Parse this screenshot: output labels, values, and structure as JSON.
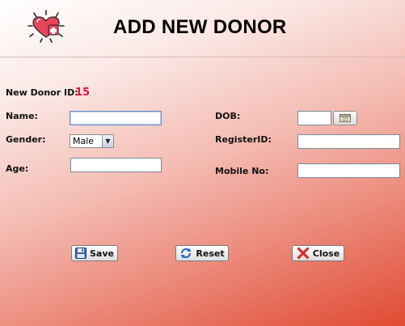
{
  "header": {
    "title": "ADD NEW DONOR",
    "logo_icon": "heart-logo-icon"
  },
  "donor": {
    "id_label": "New Donor ID:",
    "id_value": "15"
  },
  "form": {
    "name_label": "Name:",
    "name_value": "",
    "gender_label": "Gender:",
    "gender_value": "Male",
    "age_label": "Age:",
    "age_value": "",
    "dob_label": "DOB:",
    "dob_value": "",
    "register_label": "RegisterID:",
    "register_value": "",
    "mobile_label": "Mobile No:",
    "mobile_value": ""
  },
  "buttons": {
    "save": "Save",
    "reset": "Reset",
    "close": "Close"
  },
  "colors": {
    "donor_id": "#e0163c",
    "heart": "#e8455b"
  }
}
